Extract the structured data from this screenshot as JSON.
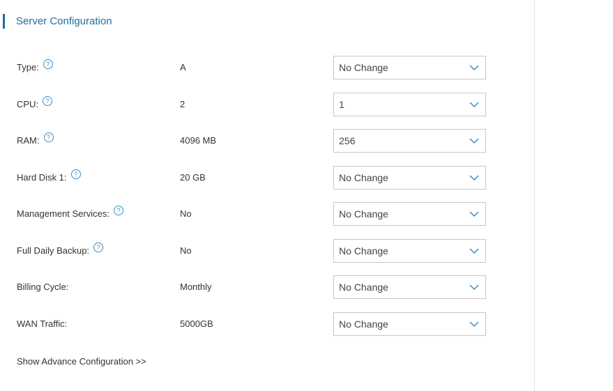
{
  "section": {
    "title": "Server Configuration"
  },
  "rows": [
    {
      "label": "Type:",
      "help": true,
      "current": "A",
      "selected": "No Change"
    },
    {
      "label": "CPU:",
      "help": true,
      "current": "2",
      "selected": "1"
    },
    {
      "label": "RAM:",
      "help": true,
      "current": "4096 MB",
      "selected": "256"
    },
    {
      "label": "Hard Disk 1:",
      "help": true,
      "current": "20 GB",
      "selected": "No Change"
    },
    {
      "label": "Management Services:",
      "help": true,
      "current": "No",
      "selected": "No Change"
    },
    {
      "label": "Full Daily Backup:",
      "help": true,
      "current": "No",
      "selected": "No Change"
    },
    {
      "label": "Billing Cycle:",
      "help": false,
      "current": "Monthly",
      "selected": "No Change"
    },
    {
      "label": "WAN Traffic:",
      "help": false,
      "current": "5000GB",
      "selected": "No Change"
    }
  ],
  "help_glyph": "?",
  "advance_link": "Show Advance Configuration >>",
  "colors": {
    "accent": "#1e6f9f",
    "help_icon": "#3a8dc4",
    "select_border": "#c7c7c7",
    "chevron": "#3a8dc4",
    "panel_divider": "#e3e3e3"
  }
}
